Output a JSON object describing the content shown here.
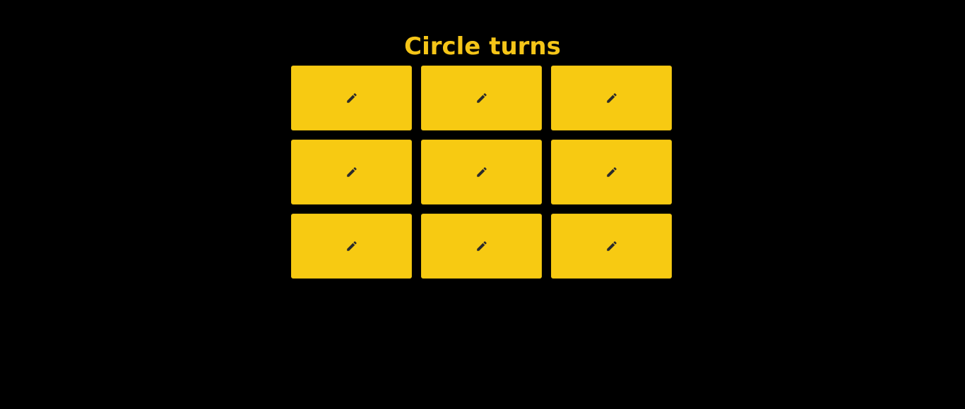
{
  "status": {
    "title": "Circle turns"
  },
  "board": {
    "cells": [
      {
        "row": 1,
        "col": 1,
        "state": "empty",
        "icon": "pencil-icon"
      },
      {
        "row": 1,
        "col": 2,
        "state": "empty",
        "icon": "pencil-icon"
      },
      {
        "row": 1,
        "col": 3,
        "state": "empty",
        "icon": "pencil-icon"
      },
      {
        "row": 2,
        "col": 1,
        "state": "empty",
        "icon": "pencil-icon"
      },
      {
        "row": 2,
        "col": 2,
        "state": "empty",
        "icon": "pencil-icon"
      },
      {
        "row": 2,
        "col": 3,
        "state": "empty",
        "icon": "pencil-icon"
      },
      {
        "row": 3,
        "col": 1,
        "state": "empty",
        "icon": "pencil-icon"
      },
      {
        "row": 3,
        "col": 2,
        "state": "empty",
        "icon": "pencil-icon"
      },
      {
        "row": 3,
        "col": 3,
        "state": "empty",
        "icon": "pencil-icon"
      }
    ]
  },
  "colors": {
    "background": "#000000",
    "accent": "#f5c518",
    "cell": "#f7ca12",
    "icon": "#2b2b2b"
  }
}
